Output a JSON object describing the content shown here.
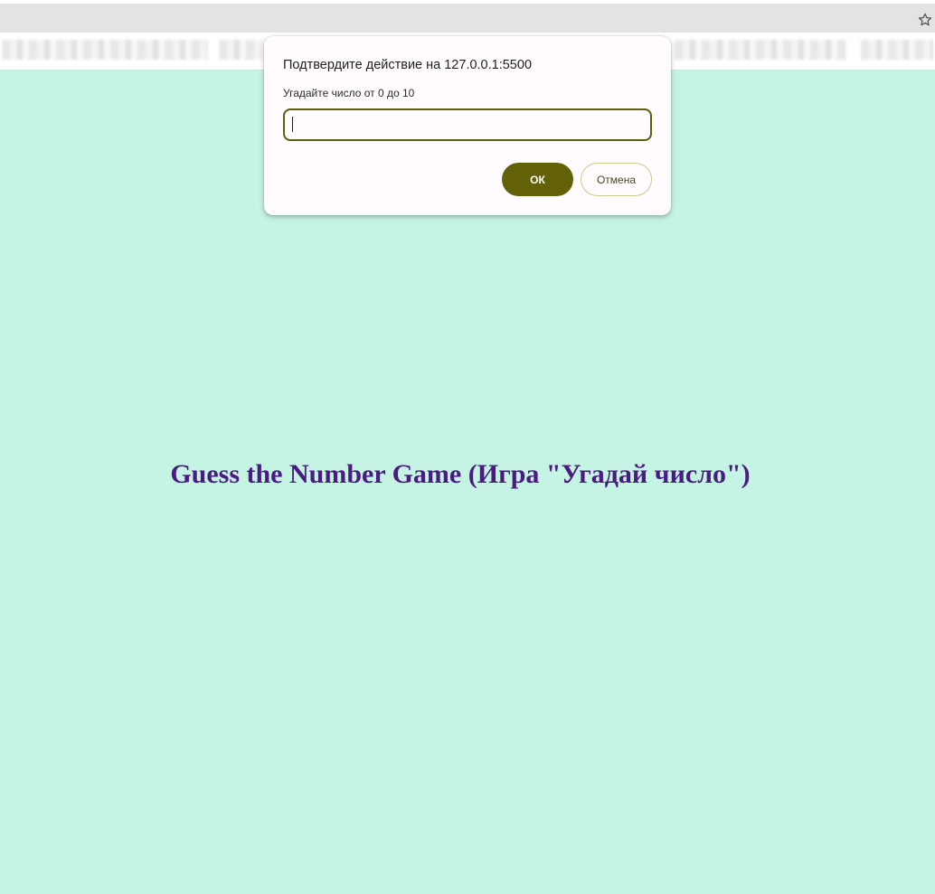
{
  "browser": {
    "star_icon": "star-outline-icon"
  },
  "dialog": {
    "title": "Подтвердите действие на 127.0.0.1:5500",
    "message": "Угадайте число от 0 до 10",
    "input_value": "",
    "ok_label": "ОК",
    "cancel_label": "Отмена",
    "colors": {
      "accent": "#636107",
      "background": "#fffbfe"
    }
  },
  "page": {
    "title": "Guess the Number Game (Игра \"Угадай число\")",
    "colors": {
      "background": "#c6f4e4",
      "title": "#4b1b82"
    }
  }
}
